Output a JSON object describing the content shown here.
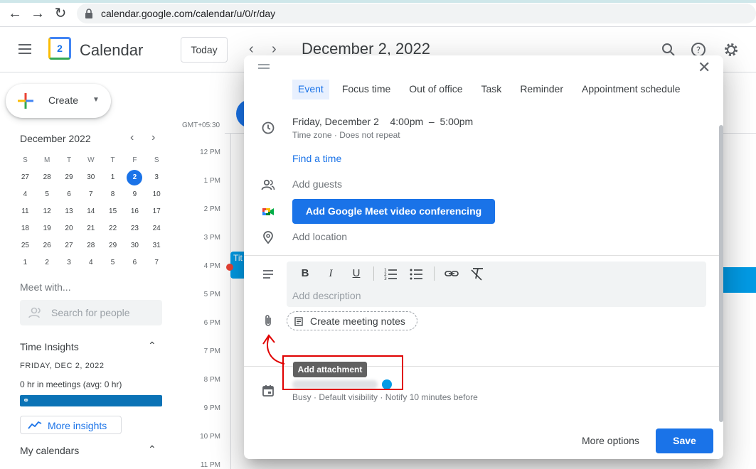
{
  "browser": {
    "url": "calendar.google.com/calendar/u/0/r/day"
  },
  "header": {
    "app_name": "Calendar",
    "logo_day": "2",
    "today_label": "Today",
    "current_date": "December 2, 2022"
  },
  "sidebar": {
    "create_label": "Create",
    "mini_calendar": {
      "title": "December 2022",
      "weekdays": [
        "S",
        "M",
        "T",
        "W",
        "T",
        "F",
        "S"
      ],
      "weeks": [
        [
          "27",
          "28",
          "29",
          "30",
          "1",
          "2",
          "3"
        ],
        [
          "4",
          "5",
          "6",
          "7",
          "8",
          "9",
          "10"
        ],
        [
          "11",
          "12",
          "13",
          "14",
          "15",
          "16",
          "17"
        ],
        [
          "18",
          "19",
          "20",
          "21",
          "22",
          "23",
          "24"
        ],
        [
          "25",
          "26",
          "27",
          "28",
          "29",
          "30",
          "31"
        ],
        [
          "1",
          "2",
          "3",
          "4",
          "5",
          "6",
          "7"
        ]
      ],
      "selected": "2"
    },
    "meet_with": {
      "title": "Meet with...",
      "search_placeholder": "Search for people"
    },
    "time_insights": {
      "title": "Time Insights",
      "date": "FRIDAY, DEC 2, 2022",
      "summary": "0 hr in meetings (avg: 0 hr)",
      "more_label": "More insights"
    },
    "my_calendars_title": "My calendars"
  },
  "day_grid": {
    "timezone": "GMT+05:30",
    "hours": [
      "12 PM",
      "1 PM",
      "2 PM",
      "3 PM",
      "4 PM",
      "5 PM",
      "6 PM",
      "7 PM",
      "8 PM",
      "9 PM",
      "10 PM",
      "11 PM"
    ],
    "event_text": "Tit"
  },
  "dialog": {
    "tabs": [
      "Event",
      "Focus time",
      "Out of office",
      "Task",
      "Reminder",
      "Appointment schedule"
    ],
    "active_tab": "Event",
    "date_line": "Friday, December 2    4:00pm  –  5:00pm",
    "date_sub": "Time zone · Does not repeat",
    "find_time": "Find a time",
    "add_guests": "Add guests",
    "meet_button": "Add Google Meet video conferencing",
    "add_location": "Add location",
    "description_placeholder": "Add description",
    "toolbar": {
      "bold": "B",
      "italic": "I",
      "underline": "U"
    },
    "meeting_notes": "Create meeting notes",
    "tooltip": "Add attachment",
    "calendar_details": "Busy · Default visibility · Notify 10 minutes before",
    "more_options": "More options",
    "save": "Save"
  },
  "colors": {
    "accent": "#1a73e8",
    "annotation": "#e00000",
    "event": "#039be5"
  }
}
